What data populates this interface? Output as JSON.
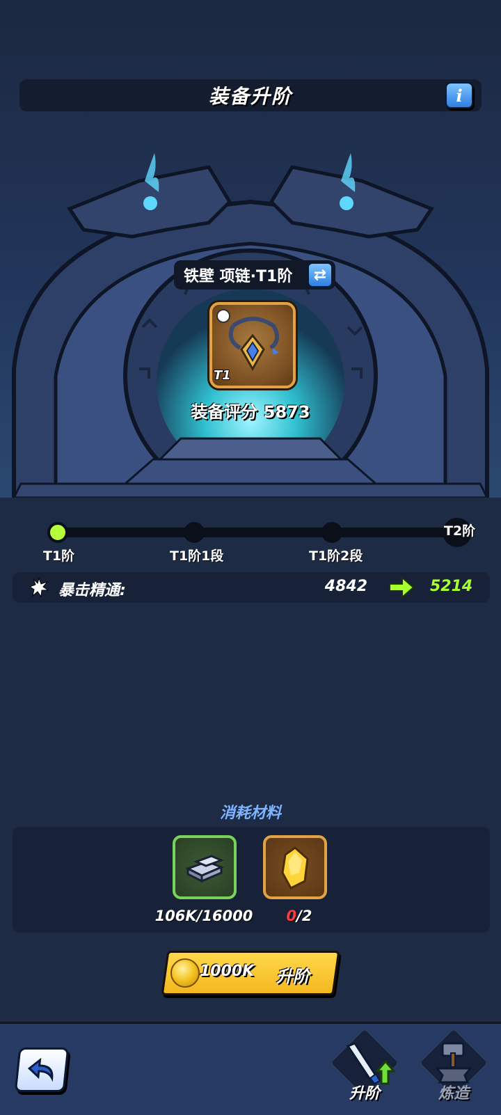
{
  "header": {
    "title": "装备升阶",
    "info_icon": "info-icon",
    "info_label": "i"
  },
  "item": {
    "name": "铁壁 项链·T1阶",
    "tier_badge": "T1",
    "score_label": "装备评分 5873",
    "swap_icon": "swap-arrows-icon"
  },
  "progress": {
    "current_index": 0,
    "nodes": [
      {
        "label": "T1阶"
      },
      {
        "label": "T1阶1段"
      },
      {
        "label": "T1阶2段"
      }
    ],
    "end_label": "T2阶"
  },
  "stat": {
    "icon": "star-burst-icon",
    "label": "暴击精通:",
    "old_value": "4842",
    "new_value": "5214"
  },
  "materials": {
    "title": "消耗材料",
    "items": [
      {
        "icon": "iron-ingot-icon",
        "count_have": "106K",
        "count_need": "16000"
      },
      {
        "icon": "gold-crystal-icon",
        "count_have": "0",
        "count_need": "2"
      }
    ]
  },
  "upgrade": {
    "cost": "1000K",
    "label": "升阶",
    "coin_icon": "gold-coin-icon"
  },
  "nav": {
    "back_icon": "back-arrow-icon",
    "tabs": [
      {
        "label": "升阶",
        "icon": "sword-upgrade-icon",
        "active": true
      },
      {
        "label": "炼造",
        "icon": "forge-anvil-icon",
        "active": false
      }
    ]
  },
  "colors": {
    "accent_green": "#a8ff2e",
    "button_gold": "#f3b81f",
    "panel_dark": "#172238",
    "rarity_gold": "#e3a244"
  }
}
